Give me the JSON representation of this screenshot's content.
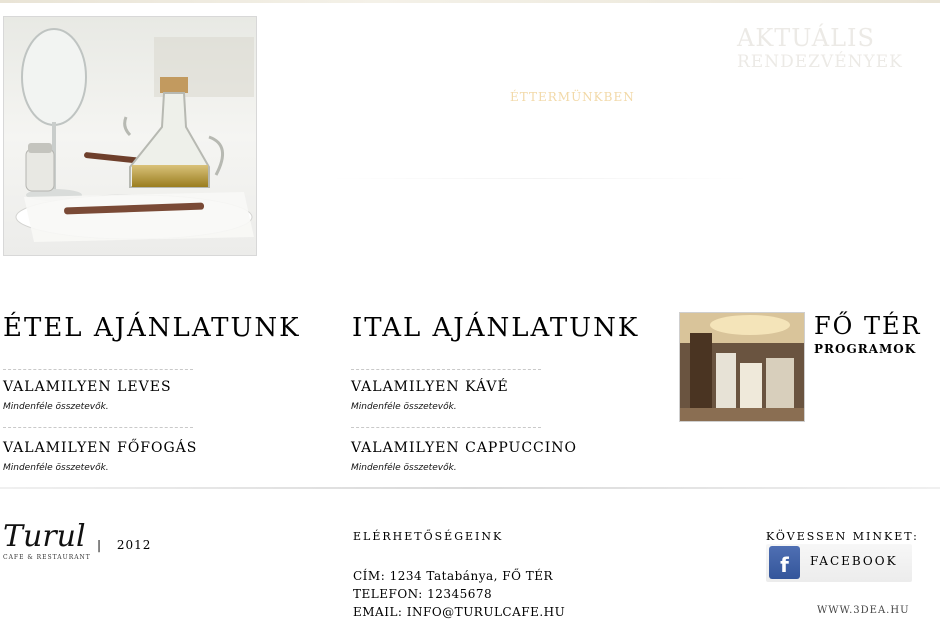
{
  "hero": {
    "photo_alt": "restaurant table with olive oil",
    "events_heading_line1": "AKTUÁLIS",
    "events_heading_line2": "RENDEZVÉNYEK",
    "restaurant_label": "ÉTTERMÜNKBEN"
  },
  "food": {
    "title": "ÉTEL AJÁNLATUNK",
    "items": [
      {
        "name": "VALAMILYEN LEVES",
        "desc": "Mindenféle összetevők."
      },
      {
        "name": "VALAMILYEN FŐFOGÁS",
        "desc": "Mindenféle összetevők."
      }
    ]
  },
  "drinks": {
    "title": "ITAL AJÁNLATUNK",
    "items": [
      {
        "name": "VALAMILYEN KÁVÉ",
        "desc": "Mindenféle összetevők."
      },
      {
        "name": "VALAMILYEN CAPPUCCINO",
        "desc": "Mindenféle összetevők."
      }
    ]
  },
  "main_square": {
    "title": "FŐ TÉR",
    "subtitle": "PROGRAMOK"
  },
  "footer": {
    "logo_text": "Turul",
    "logo_tagline": "CAFE & RESTAURANT",
    "separator": "|",
    "year": "2012",
    "contact_heading": "ELÉRHETŐSÉGEINK",
    "address": "CÍM: 1234 Tatabánya, FŐ TÉR",
    "phone": "TELEFON: 12345678",
    "email": "EMAIL: INFO@TURULCAFE.HU",
    "follow_heading": "KÖVESSEN MINKET:",
    "facebook_label": "FACEBOOK",
    "credit": "WWW.3DEA.HU"
  },
  "colors": {
    "restaurant_label": "#f2d9a8",
    "events_heading": "#eceae6",
    "facebook_blue": "#3b5998"
  }
}
